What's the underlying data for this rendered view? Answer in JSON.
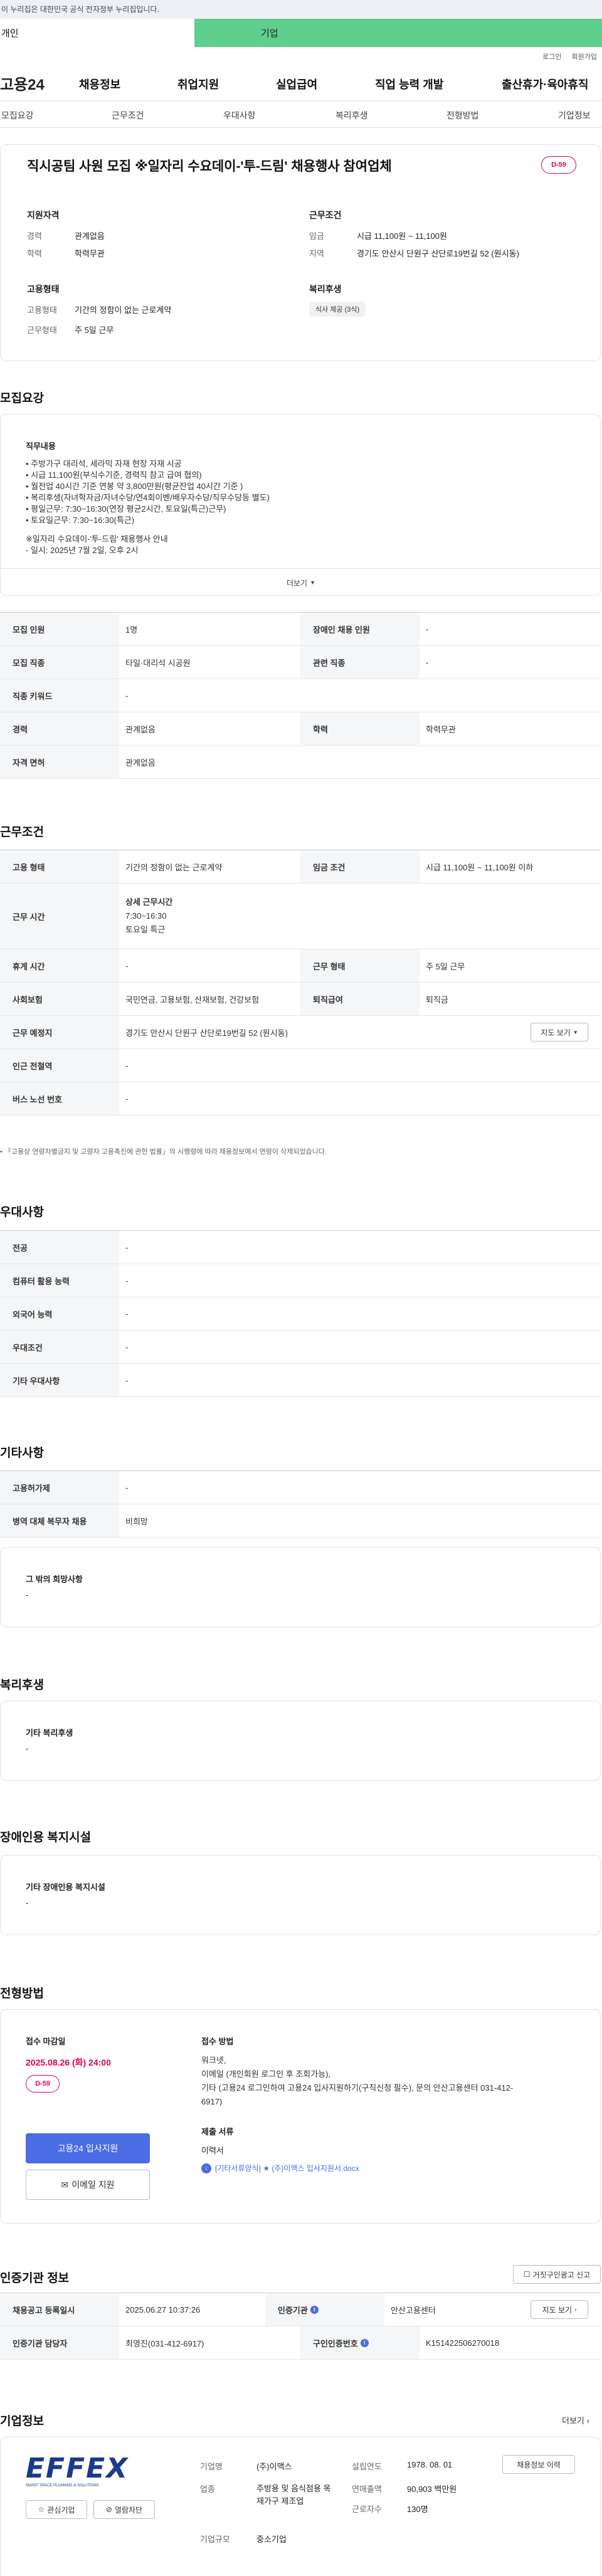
{
  "gov_banner": "이 누리집은 대한민국 공식 전자정부 누리집입니다.",
  "tabs": {
    "personal": "개인",
    "company": "기업"
  },
  "toplinks": {
    "login": "로그인",
    "join": "회원가입"
  },
  "gnb": {
    "logo": "고용24",
    "menus": [
      "채용정보",
      "취업지원",
      "실업급여",
      "직업 능력 개발",
      "출산휴가·육아휴직"
    ]
  },
  "subnav": [
    "모집요강",
    "근무조건",
    "우대사항",
    "복리후생",
    "전형방법",
    "기업정보"
  ],
  "job": {
    "title": "직시공팀 사원 모집 ※일자리 수요데이-'투-드림' 채용행사 참여업체",
    "dday": "D-59",
    "qual_title": "지원자격",
    "career_lbl": "경력",
    "career_val": "관계없음",
    "edu_lbl": "학력",
    "edu_val": "학력무관",
    "cond_title": "근무조건",
    "wage_lbl": "임금",
    "wage_val": "시급 11,100원 ~ 11,100원",
    "area_lbl": "지역",
    "area_val": "경기도 안산시 단원구 산단로19번길 52 (원시동)",
    "emp_title": "고용형태",
    "emp_type_lbl": "고용형태",
    "emp_type_val": "기간의 정함이 없는 근로계약",
    "work_lbl": "근무형태",
    "work_val": "주 5일 근무",
    "welfare_title": "복리후생",
    "welfare_chip": "식사 제공 (3식)"
  },
  "recruit": {
    "title": "모집요강",
    "duty_title": "직무내용",
    "duty_lines": [
      "• 주방가구 대리석, 세라믹 자재 현장 자재 시공",
      "• 시급 11,100원(부식수기준, 경력직 참고 급여 협의)",
      "• 월전업 40시간 기준 연봉 약 3,800만원(평균잔업 40시간 기준 )",
      "• 복리후생(자녀학자금/자녀수당/연4회이벤/배우자수당/직무수당등 별도)",
      "• 평일근무: 7:30~16:30(연장 평균2시간, 토요일(특근)근무)",
      "• 토요일근무: 7:30~16:30(특근)",
      "",
      "※일자리 수요데이-'투-드림' 채용행사 안내",
      "- 일시: 2025년 7월 2일, 오후 2시"
    ],
    "more": "더보기",
    "rows": [
      {
        "l1": "모집 인원",
        "v1": "1명",
        "l2": "장애인 채용 인원",
        "v2": "-"
      },
      {
        "l1": "모집 직종",
        "v1": "타일·대리석 시공원",
        "l2": "관련 직종",
        "v2": "-"
      },
      {
        "l1": "직종 키워드",
        "v1": "-"
      },
      {
        "l1": "경력",
        "v1": "관계없음",
        "l2": "학력",
        "v2": "학력무관"
      },
      {
        "l1": "자격 면허",
        "v1": "관계없음"
      }
    ]
  },
  "work_cond": {
    "title": "근무조건",
    "emp_lbl": "고용 형태",
    "emp_val": "기간의 정함이 없는 근로계약",
    "wage_lbl": "임금 조건",
    "wage_val": "시급 11,100원 ~ 11,100원 이하",
    "time_lbl": "근무 시간",
    "time_head": "상세 근무시간",
    "time_1": "7:30~16:30",
    "time_2": "토요일 특근",
    "break_lbl": "휴게 시간",
    "break_val": "-",
    "form_lbl": "근무 형태",
    "form_val": "주 5일 근무",
    "ins_lbl": "사회보험",
    "ins_val": "국민연금, 고용보험, 산재보험, 건강보험",
    "ret_lbl": "퇴직급여",
    "ret_val": "퇴직금",
    "place_lbl": "근무 예정지",
    "place_val": "경기도 안산시 단원구 산단로19번길 52 (원시동)",
    "map_btn": "지도 보기",
    "subway_lbl": "인근 전철역",
    "subway_val": "-",
    "bus_lbl": "버스 노선 번호",
    "bus_val": "-",
    "note": "• 「고용상 연령차별금지 및 고령자 고용촉진에 관한 법률」의 시행령에 따라 채용정보에서 연령이 삭제되었습니다."
  },
  "prefer": {
    "title": "우대사항",
    "rows": [
      {
        "l": "전공",
        "v": "-"
      },
      {
        "l": "컴퓨터 활용 능력",
        "v": "-"
      },
      {
        "l": "외국어 능력",
        "v": "-"
      },
      {
        "l": "우대조건",
        "v": "-"
      },
      {
        "l": "기타 우대사항",
        "v": "-"
      }
    ]
  },
  "etc": {
    "title": "기타사항",
    "rows": [
      {
        "l": "고용허가제",
        "v": "-"
      },
      {
        "l": "병역 대체 복무자 채용",
        "v": "비희망"
      }
    ],
    "hope_title": "그 밖의 희망사항",
    "hope_val": "-"
  },
  "welfare": {
    "title": "복리후생",
    "box_title": "기타 복리후생",
    "box_val": "-"
  },
  "disabled": {
    "title": "장애인용 복지시설",
    "box_title": "기타 장애인용 복지시설",
    "box_val": "-"
  },
  "selection": {
    "title": "전형방법",
    "deadline_lbl": "접수 마감일",
    "deadline": "2025.08.26 (화) 24:00",
    "dday": "D-59",
    "apply_btn": "고용24 입사지원",
    "email_btn": "이메일 지원",
    "method_lbl": "접수 방법",
    "method_lines": [
      "워크넷,",
      "이메일 (개인회원 로그인 후 조회가능),",
      "기타 (고용24 로그인하여 고용24 입사지원하기(구직신청 필수), 문의 안산고용센터 031-412-",
      "6917)"
    ],
    "docs_lbl": "제출 서류",
    "docs_val": "이력서",
    "file": "[기타서류양식] ★ (주)이맥스 입사지원서.docx"
  },
  "certify": {
    "title": "인증기관 정보",
    "btn": "거짓구인광고 신고",
    "r1l1": "채용공고 등록일시",
    "r1v1": "2025.06.27 10:37:26",
    "r1l2": "인증기관",
    "r1v2": "안산고용센터",
    "map_btn": "지도 보기",
    "r2l1": "인증기관 담당자",
    "r2v1": "최영진(031-412-6917)",
    "r2l2": "구인인증번호",
    "r2v2": "K151422506270018"
  },
  "company": {
    "title": "기업정보",
    "more": "더보기",
    "logo_text": "EFFEX",
    "logo_sub": "SMART SPACE PLANNING & SOLUTIONS",
    "fav_btn": "관심기업",
    "block_btn": "열람차단",
    "name_lbl": "기업명",
    "name_val": "(주)이맥스",
    "found_lbl": "설립연도",
    "found_val": "1978. 08. 01",
    "ind_lbl": "업종",
    "ind_val": "주방용 및 음식점용 목재가구 제조업",
    "sales_lbl": "연매출액",
    "sales_val": "90,903 백만원",
    "emp_lbl": "근로자수",
    "emp_val": "130명",
    "size_lbl": "기업규모",
    "size_val": "중소기업",
    "job_btn": "채용정보 이력"
  },
  "colors": {
    "accent": "#4a6de5",
    "green": "#5fcf8e",
    "dday": "#e0005a"
  }
}
